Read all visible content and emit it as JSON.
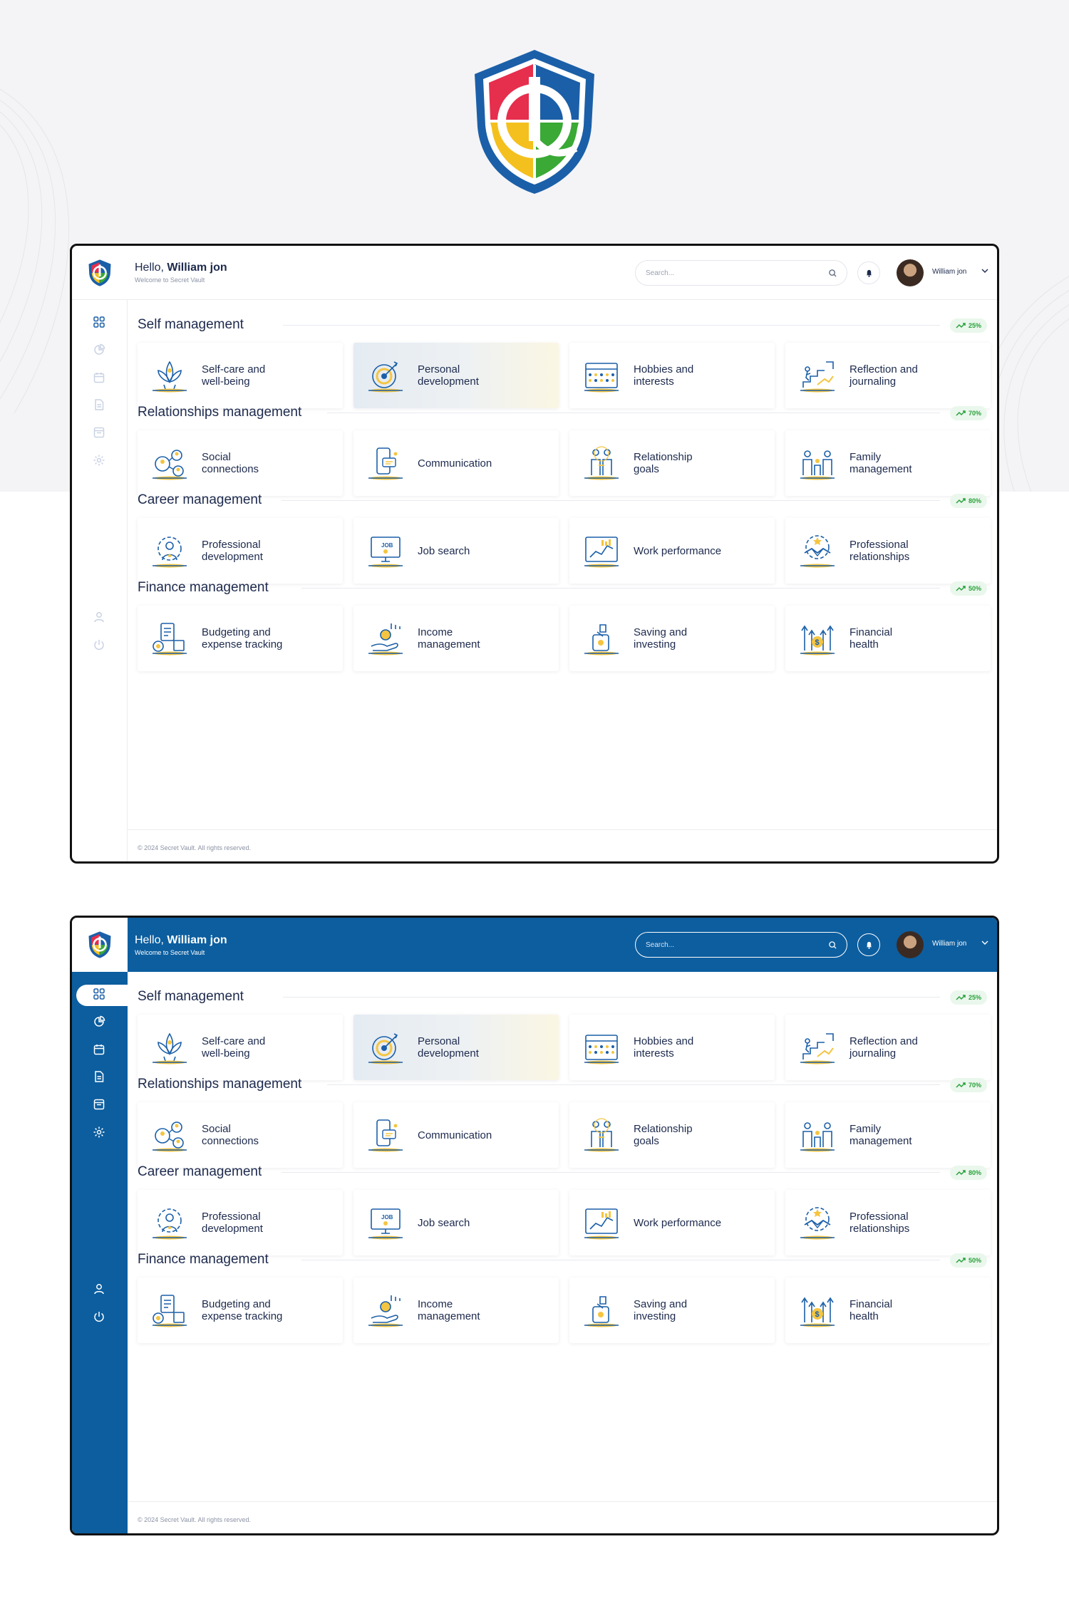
{
  "colors": {
    "brand_blue": "#0c5e9f",
    "navy_text": "#1d2a4d",
    "success_green": "#2aa13b",
    "icon_blue": "#1b5fa8",
    "icon_yellow": "#f4c542"
  },
  "header": {
    "hello_prefix": "Hello,",
    "user_name": "William jon",
    "subtitle": "Welcome to Secret Vault",
    "search_placeholder": "Search...",
    "profile_name": "William jon"
  },
  "sidebar": {
    "items": [
      {
        "name": "dashboard-icon"
      },
      {
        "name": "chart-pie-icon"
      },
      {
        "name": "calendar-icon"
      },
      {
        "name": "document-icon"
      },
      {
        "name": "calendar-box-icon"
      },
      {
        "name": "gear-icon"
      },
      {
        "name": "user-icon"
      },
      {
        "name": "power-icon"
      }
    ]
  },
  "sections": [
    {
      "title": "Self management",
      "progress": "25%",
      "cards": [
        {
          "label_1": "Self-care and",
          "label_2": "well-being",
          "icon": "lotus-icon"
        },
        {
          "label_1": "Personal",
          "label_2": "development",
          "icon": "target-icon"
        },
        {
          "label_1": "Hobbies and",
          "label_2": "interests",
          "icon": "calendar-grid-icon"
        },
        {
          "label_1": "Reflection and",
          "label_2": "journaling",
          "icon": "stairs-growth-icon"
        }
      ]
    },
    {
      "title": "Relationships management",
      "progress": "70%",
      "cards": [
        {
          "label_1": "Social",
          "label_2": "connections",
          "icon": "social-network-icon"
        },
        {
          "label_1": "Communication",
          "label_2": "",
          "icon": "phone-chat-icon"
        },
        {
          "label_1": "Relationship",
          "label_2": "goals",
          "icon": "couple-icon"
        },
        {
          "label_1": "Family",
          "label_2": "management",
          "icon": "family-icon"
        }
      ]
    },
    {
      "title": "Career management",
      "progress": "80%",
      "cards": [
        {
          "label_1": "Professional",
          "label_2": "development",
          "icon": "gear-person-icon"
        },
        {
          "label_1": "Job search",
          "label_2": "",
          "icon": "job-monitor-icon"
        },
        {
          "label_1": "Work performance",
          "label_2": "",
          "icon": "performance-chart-icon"
        },
        {
          "label_1": "Professional",
          "label_2": "relationships",
          "icon": "handshake-icon"
        }
      ]
    },
    {
      "title": "Finance management",
      "progress": "50%",
      "cards": [
        {
          "label_1": "Budgeting and",
          "label_2": "expense tracking",
          "icon": "budget-icon"
        },
        {
          "label_1": "Income",
          "label_2": "management",
          "icon": "coin-hand-icon"
        },
        {
          "label_1": "Saving and",
          "label_2": "investing",
          "icon": "piggy-jar-icon"
        },
        {
          "label_1": "Financial",
          "label_2": "health",
          "icon": "dollar-arrows-icon"
        }
      ]
    }
  ],
  "footer": {
    "copyright": "© 2024 Secret Vault. All rights reserved."
  }
}
